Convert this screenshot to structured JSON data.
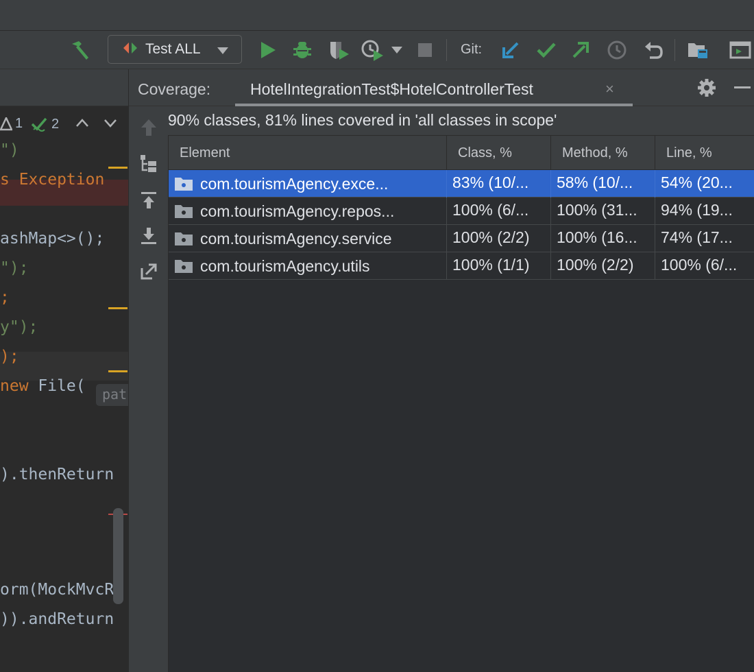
{
  "toolbar": {
    "run_config_label": "Test ALL",
    "git_label": "Git:"
  },
  "editor": {
    "inspections": {
      "warnings": "1",
      "weak_warnings": "2"
    },
    "code_lines": [
      {
        "parts": [
          {
            "t": "\")",
            "c": "str"
          }
        ]
      },
      {
        "parts": [
          {
            "t": "s Exception",
            "c": "kw"
          }
        ]
      },
      {
        "parts": []
      },
      {
        "parts": [
          {
            "t": "ashMap<>();",
            "c": "pun"
          }
        ]
      },
      {
        "parts": [
          {
            "t": "\");",
            "c": "str"
          }
        ]
      },
      {
        "parts": [
          {
            "t": ";",
            "c": "kw"
          }
        ]
      },
      {
        "parts": [
          {
            "t": "y\");",
            "c": "str"
          }
        ]
      },
      {
        "parts": [
          {
            "t": ");",
            "c": "kw"
          }
        ]
      },
      {
        "parts": [
          {
            "t": "new ",
            "c": "kw"
          },
          {
            "t": "File(",
            "c": "pun"
          }
        ]
      },
      {
        "parts": []
      },
      {
        "parts": []
      },
      {
        "parts": [
          {
            "t": ").thenReturn",
            "c": "pun"
          }
        ]
      },
      {
        "parts": []
      },
      {
        "parts": []
      },
      {
        "parts": []
      },
      {
        "parts": [
          {
            "t": "orm(MockMvcR",
            "c": "pun"
          }
        ]
      },
      {
        "parts": [
          {
            "t": ")).andReturn",
            "c": "pun"
          }
        ]
      }
    ],
    "param_hint": "pat"
  },
  "coverage": {
    "title": "Coverage:",
    "tab_label": "HotelIntegrationTest$HotelControllerTest",
    "tab_close": "×",
    "summary": "90% classes, 81% lines covered in 'all classes in scope'",
    "columns": [
      "Element",
      "Class, %",
      "Method, %",
      "Line, %"
    ],
    "rows": [
      {
        "element": "com.tourismAgency.exce...",
        "class_pct": "83% (10/...",
        "method_pct": "58% (10/...",
        "line_pct": "54% (20...",
        "selected": true
      },
      {
        "element": "com.tourismAgency.repos...",
        "class_pct": "100% (6/...",
        "method_pct": "100% (31...",
        "line_pct": "94% (19...",
        "selected": false
      },
      {
        "element": "com.tourismAgency.service",
        "class_pct": "100% (2/2)",
        "method_pct": "100% (16...",
        "line_pct": "74% (17...",
        "selected": false
      },
      {
        "element": "com.tourismAgency.utils",
        "class_pct": "100% (1/1)",
        "method_pct": "100% (2/2)",
        "line_pct": "100% (6/...",
        "selected": false
      }
    ]
  },
  "colors": {
    "accent_selection": "#2f65ca",
    "run_green": "#499c54",
    "git_blue": "#3592c4",
    "warning_yellow": "#d8a324"
  },
  "icons": {
    "build": "hammer-icon",
    "run": "run-icon",
    "debug": "debug-icon",
    "coverage": "run-with-coverage-icon",
    "profile": "profile-icon",
    "stop": "stop-icon",
    "git_update": "git-update-icon",
    "git_commit": "git-commit-icon",
    "git_push": "git-push-icon",
    "git_history": "history-icon",
    "git_rollback": "rollback-icon"
  }
}
